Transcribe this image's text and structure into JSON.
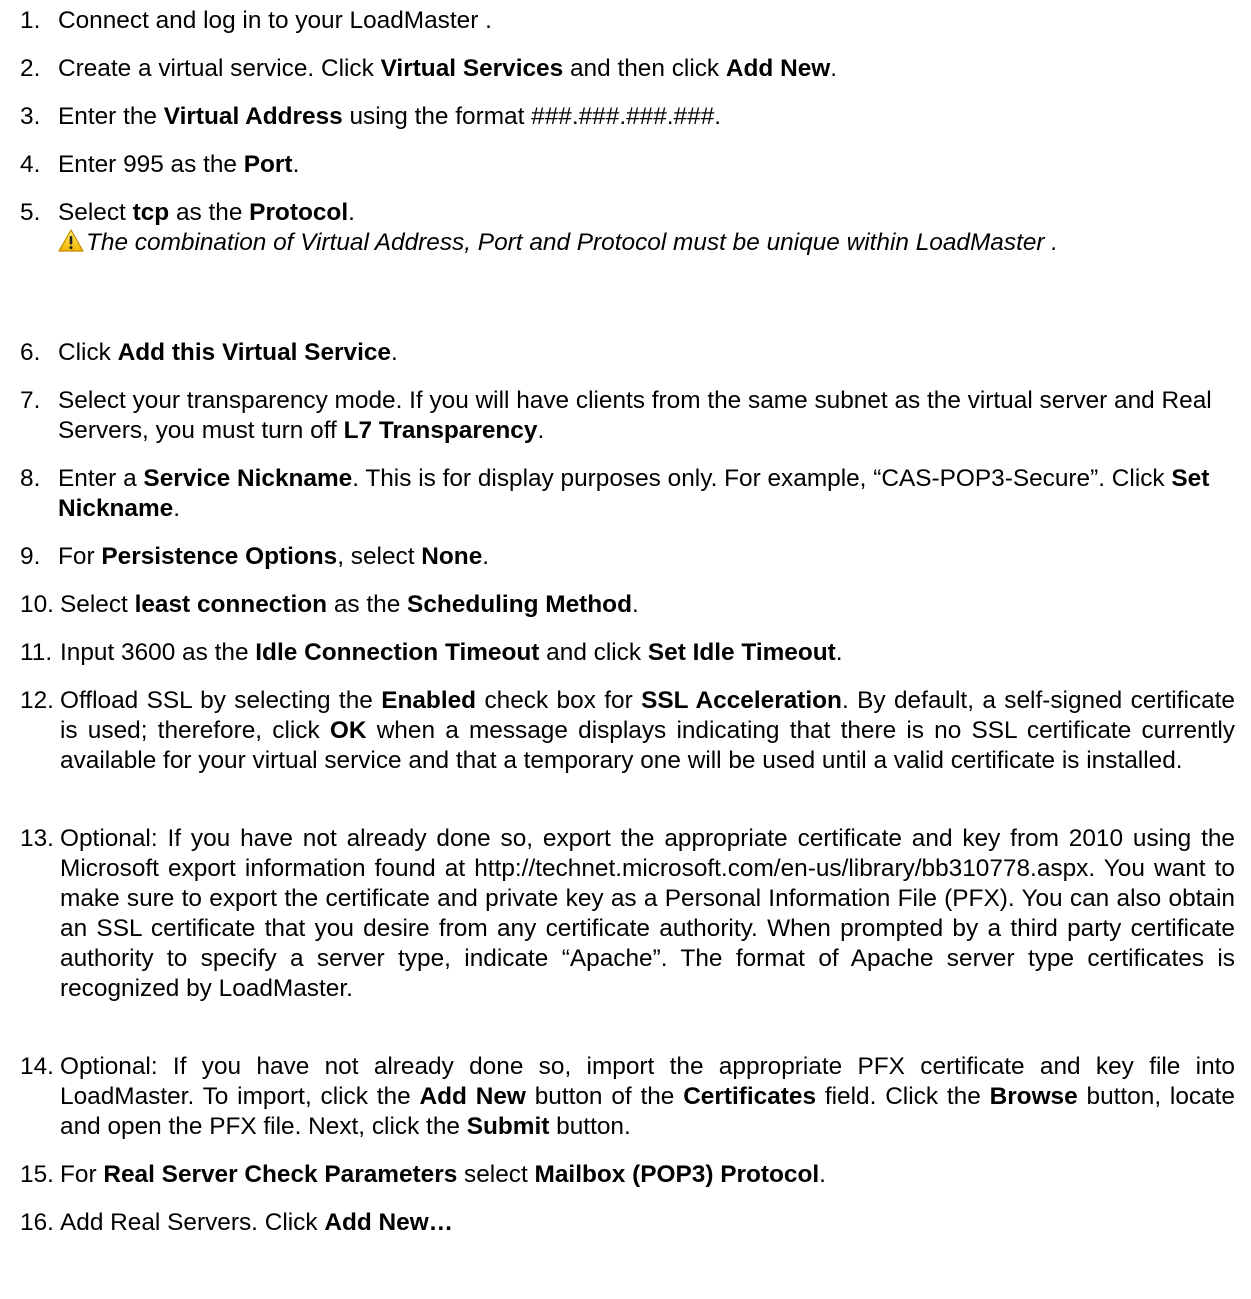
{
  "steps": [
    {
      "num": "1.",
      "segs": [
        {
          "t": "Connect and log in to your LoadMaster  ."
        }
      ]
    },
    {
      "num": "2.",
      "segs": [
        {
          "t": "Create a virtual service. Click "
        },
        {
          "t": "Virtual Services",
          "b": true
        },
        {
          "t": " and then click "
        },
        {
          "t": "Add New",
          "b": true
        },
        {
          "t": "."
        }
      ]
    },
    {
      "num": "3.",
      "segs": [
        {
          "t": "Enter the "
        },
        {
          "t": "Virtual Address",
          "b": true
        },
        {
          "t": " using the format ###.###.###.###."
        }
      ]
    },
    {
      "num": "4.",
      "segs": [
        {
          "t": "Enter 995 as the "
        },
        {
          "t": "Port",
          "b": true
        },
        {
          "t": "."
        }
      ]
    },
    {
      "num": "5.",
      "segs": [
        {
          "t": "Select "
        },
        {
          "t": "tcp",
          "b": true
        },
        {
          "t": " as the "
        },
        {
          "t": "Protocol",
          "b": true
        },
        {
          "t": "."
        }
      ]
    },
    {
      "num": "6.",
      "segs": [
        {
          "t": "Click "
        },
        {
          "t": "Add this Virtual Service",
          "b": true
        },
        {
          "t": "."
        }
      ]
    },
    {
      "num": "7.",
      "segs": [
        {
          "t": "Select your transparency mode. If you will have clients from the same subnet as the virtual server and Real Servers, you must turn off "
        },
        {
          "t": "L7 Transparency",
          "b": true
        },
        {
          "t": "."
        }
      ]
    },
    {
      "num": "8.",
      "segs": [
        {
          "t": "Enter a "
        },
        {
          "t": "Service Nickname",
          "b": true
        },
        {
          "t": ". This is for display purposes only. For example, “CAS-POP3-Secure”. Click "
        },
        {
          "t": "Set Nickname",
          "b": true
        },
        {
          "t": "."
        }
      ]
    },
    {
      "num": "9.",
      "segs": [
        {
          "t": "For "
        },
        {
          "t": "Persistence Options",
          "b": true
        },
        {
          "t": ", select "
        },
        {
          "t": "None",
          "b": true
        },
        {
          "t": "."
        }
      ]
    },
    {
      "num": "10.",
      "segs": [
        {
          "t": "Select "
        },
        {
          "t": "least connection",
          "b": true
        },
        {
          "t": " as the "
        },
        {
          "t": "Scheduling Method",
          "b": true
        },
        {
          "t": "."
        }
      ]
    },
    {
      "num": "11.",
      "segs": [
        {
          "t": "Input 3600 as the "
        },
        {
          "t": "Idle Connection Timeout",
          "b": true
        },
        {
          "t": " and click "
        },
        {
          "t": "Set Idle Timeout",
          "b": true
        },
        {
          "t": "."
        }
      ]
    },
    {
      "num": "12.",
      "segs": [
        {
          "t": "Offload SSL by selecting the "
        },
        {
          "t": "Enabled",
          "b": true
        },
        {
          "t": " check box for "
        },
        {
          "t": "SSL Acceleration",
          "b": true
        },
        {
          "t": ". By default, a self-signed certificate is used; therefore, click "
        },
        {
          "t": "OK",
          "b": true
        },
        {
          "t": " when a message displays indicating that there is no SSL certificate currently available for your virtual service and that a temporary one will be used until a valid certificate is installed."
        }
      ]
    },
    {
      "num": "13.",
      "segs": [
        {
          "t": "Optional: If you have not already done so, export the appropriate certificate and key from 2010 using the Microsoft export information found at http://technet.microsoft.com/en-us/library/bb310778.aspx. You want to make sure to export the certificate and private key as a Personal Information  File (PFX). You can also obtain an SSL certificate that you desire from any certificate authority. When prompted by a third party certificate authority to specify a server type, indicate “Apache”. The format of Apache server type certificates is recognized by LoadMaster."
        }
      ]
    },
    {
      "num": "14.",
      "segs": [
        {
          "t": "Optional: If you have not already done so, import the appropriate PFX certificate and key file into LoadMaster. To import, click the "
        },
        {
          "t": "Add New",
          "b": true
        },
        {
          "t": " button of the "
        },
        {
          "t": "Certificates",
          "b": true
        },
        {
          "t": " field. Click the "
        },
        {
          "t": "Browse",
          "b": true
        },
        {
          "t": " button, locate and open the PFX file. Next, click the "
        },
        {
          "t": "Submit",
          "b": true
        },
        {
          "t": " button."
        }
      ]
    },
    {
      "num": "15.",
      "segs": [
        {
          "t": "For "
        },
        {
          "t": "Real Server Check Parameters",
          "b": true
        },
        {
          "t": " select "
        },
        {
          "t": "Mailbox (POP3) Protocol",
          "b": true
        },
        {
          "t": "."
        }
      ]
    },
    {
      "num": "16.",
      "segs": [
        {
          "t": "Add Real Servers. Click "
        },
        {
          "t": "Add New…",
          "b": true
        }
      ]
    }
  ],
  "note": {
    "icon": "warning-icon",
    "text": "The combination of Virtual Address, Port and Protocol must be unique within LoadMaster  ."
  }
}
